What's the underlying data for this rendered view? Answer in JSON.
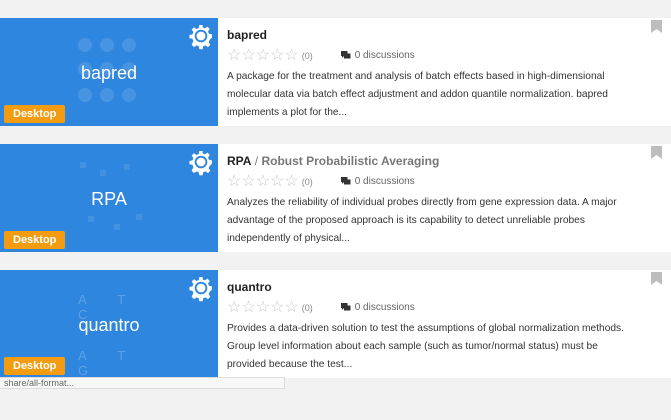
{
  "colors": {
    "thumb_bg": "#2e86de",
    "badge_bg": "#f39c12",
    "star": "#c9c9c9",
    "bookmark": "#bdbdbd"
  },
  "icons": {
    "settings": "gear-icon",
    "discussions": "chat-bubbles-icon",
    "bookmark": "bookmark-icon",
    "rating": "star-outline-icon"
  },
  "packages": [
    {
      "thumb_title": "bapred",
      "badge": "Desktop",
      "name": "bapred",
      "separator": "",
      "subtitle": "",
      "rating_count": "(0)",
      "discussions": "0 discussions",
      "description": "A package for the treatment and analysis of batch effects based in high-dimensional molecular data via batch effect adjustment and addon quantile normalization. bapred implements a plot for the..."
    },
    {
      "thumb_title": "RPA",
      "badge": "Desktop",
      "name": "RPA",
      "separator": " / ",
      "subtitle": "Robust Probabilistic Averaging",
      "rating_count": "(0)",
      "discussions": "0 discussions",
      "description": "Analyzes the reliability of individual probes directly from gene expression data. A major advantage of the proposed approach is its capability to detect unreliable probes independently of physical..."
    },
    {
      "thumb_title": "quantro",
      "badge": "Desktop",
      "name": "quantro",
      "separator": "",
      "subtitle": "",
      "rating_count": "(0)",
      "discussions": "0 discussions",
      "description": "Provides a data-driven solution to test the assumptions of global normalization methods. Group level information about each sample (such as tumor/normal status) must be provided because the test..."
    }
  ],
  "thumb_letters": {
    "top": "A T C",
    "bottom": "A T G"
  },
  "status_bar": {
    "text": "share/all-format..."
  }
}
